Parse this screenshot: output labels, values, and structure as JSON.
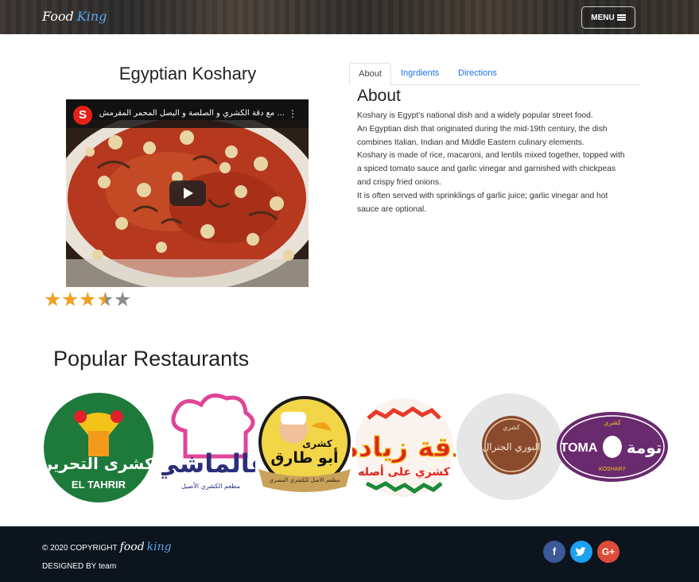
{
  "navbar": {
    "logo_word1": "Food",
    "logo_word2": "King",
    "menu_label": "MENU"
  },
  "dish": {
    "title": "Egyptian Koshary",
    "video": {
      "channel_badge": "S",
      "title": "... مع دقة الكشري و الصلصة و البصل المحمر المقرمش",
      "menu_glyph": "⋮"
    },
    "rating": 3.5,
    "rating_max": 5
  },
  "tabs": [
    {
      "label": "About",
      "active": true
    },
    {
      "label": "Ingrdients",
      "active": false
    },
    {
      "label": "Directions",
      "active": false
    }
  ],
  "about": {
    "heading": "About",
    "paragraphs": [
      "Koshary is Egypt's national dish and a widely popular street food.",
      "An Egyptian dish that originated during the mid-19th century, the dish combines Italian, Indian and Middle Eastern culinary elements.",
      "Koshary is made of rice, macaroni, and lentils mixed together, topped with a spiced tomato sauce and garlic vinegar and garnished with chickpeas and crispy fried onions.",
      "It is often served with sprinklings of garlic juice; garlic vinegar and hot sauce are optional."
    ]
  },
  "popular": {
    "heading": "Popular Restaurants",
    "restaurants": [
      {
        "name": "كشرى التحرير",
        "latin": "EL TAHRIR",
        "icon": "el-tahrir-logo"
      },
      {
        "name": "عالماشي",
        "sub": "مطعم الكشري الأصيل",
        "icon": "alamashy-logo"
      },
      {
        "name": "أبو طارق",
        "pre": "كشرى",
        "sub": "مطعم الاصل للكشري المصري",
        "icon": "abou-tarek-logo"
      },
      {
        "name": "دقة زيادة",
        "sub": "كشري على أصله",
        "icon": "da2a-zyada-logo"
      },
      {
        "name": "البوري الجنرال",
        "pre": "كشري",
        "icon": "el-bory-logo"
      },
      {
        "name": "TOMA",
        "arabic": "تومة",
        "pre": "كشري",
        "sub": "KOSHARY",
        "icon": "toma-logo"
      }
    ]
  },
  "footer": {
    "copyright": "© 2020 COPYRIGHT",
    "brand1": "food",
    "brand2": "king",
    "designed": "DESIGNED BY team",
    "social": [
      {
        "label": "f",
        "icon": "facebook-icon",
        "color": "#3b5998"
      },
      {
        "label": "🐦",
        "icon": "twitter-icon",
        "color": "#1da1f2"
      },
      {
        "label": "G+",
        "icon": "google-plus-icon",
        "color": "#dd4b39"
      }
    ]
  }
}
